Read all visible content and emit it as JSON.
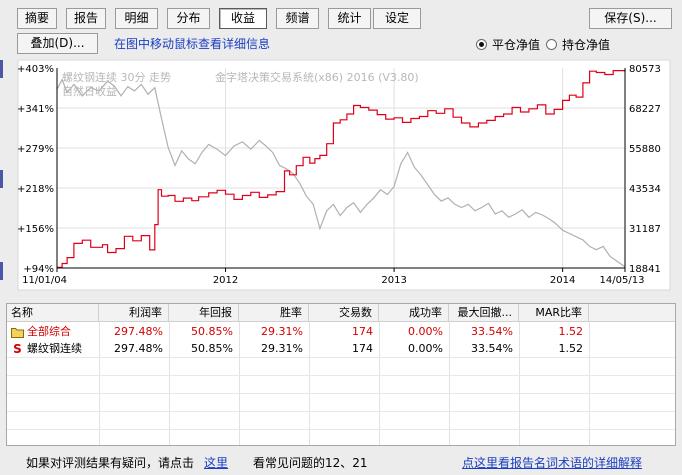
{
  "toolbar": {
    "tabs": [
      {
        "label": "摘要",
        "active": false
      },
      {
        "label": "报告",
        "active": false
      },
      {
        "label": "明细",
        "active": false
      },
      {
        "label": "分布",
        "active": false
      },
      {
        "label": "收益",
        "active": true
      },
      {
        "label": "频谱",
        "active": false
      },
      {
        "label": "统计",
        "active": false
      },
      {
        "label": "设定",
        "active": false
      }
    ],
    "save_label": "保存(S)...",
    "overlay_label": "叠加(D)...",
    "hint": "在图中移动鼠标查看详细信息",
    "mode_options": [
      {
        "label": "平仓净值",
        "selected": true
      },
      {
        "label": "持仓净值",
        "selected": false
      }
    ]
  },
  "chart": {
    "overlay_instrument": "螺纹钢连续 30分 走势",
    "overlay_system": "金字塔决策交易系统(x86) 2016 (V3.80)",
    "overlay_period": "自然日收益",
    "start_date": "11/01/04",
    "end_date": "14/05/13",
    "colors": {
      "equity": "#e0001a",
      "price": "#b0b0b0",
      "axis": "#000000"
    }
  },
  "chart_data": {
    "type": "line",
    "left_axis_ticks": [
      "+403%",
      "+341%",
      "+279%",
      "+218%",
      "+156%",
      "+94%"
    ],
    "right_axis_ticks": [
      "80573",
      "68227",
      "55880",
      "43534",
      "31187",
      "18841"
    ],
    "x_tick_labels": [
      "11/01/04",
      "2012",
      "2013",
      "2014",
      "14/05/13"
    ],
    "ylim_left_percent": [
      94,
      403
    ],
    "ylim_right_price": [
      18841,
      80573
    ],
    "x_years": [
      2011.0,
      2014.37
    ],
    "series": [
      {
        "name": "",
        "axis": "left",
        "x": [
          2011.0,
          2011.03,
          2011.06,
          2011.1,
          2011.15,
          2011.2,
          2011.27,
          2011.3,
          2011.35,
          2011.4,
          2011.45,
          2011.5,
          2011.55,
          2011.58,
          2011.6,
          2011.62,
          2011.66,
          2011.7,
          2011.75,
          2011.8,
          2011.84,
          2011.9,
          2011.95,
          2012.0,
          2012.05,
          2012.1,
          2012.15,
          2012.2,
          2012.25,
          2012.3,
          2012.35,
          2012.38,
          2012.42,
          2012.46,
          2012.5,
          2012.53,
          2012.56,
          2012.6,
          2012.64,
          2012.68,
          2012.72,
          2012.76,
          2012.8,
          2012.85,
          2012.9,
          2012.95,
          2013.0,
          2013.05,
          2013.1,
          2013.15,
          2013.2,
          2013.25,
          2013.3,
          2013.35,
          2013.4,
          2013.45,
          2013.5,
          2013.55,
          2013.6,
          2013.65,
          2013.7,
          2013.75,
          2013.8,
          2013.85,
          2013.9,
          2013.95,
          2014.0,
          2014.04,
          2014.08,
          2014.12,
          2014.16,
          2014.2,
          2014.25,
          2014.3,
          2014.37
        ],
        "values": [
          95,
          101,
          110,
          132,
          137,
          126,
          130,
          118,
          124,
          143,
          136,
          144,
          122,
          161,
          215,
          205,
          206,
          197,
          202,
          198,
          204,
          210,
          214,
          208,
          200,
          206,
          211,
          203,
          207,
          212,
          244,
          238,
          252,
          265,
          256,
          263,
          268,
          286,
          318,
          323,
          332,
          345,
          342,
          338,
          331,
          324,
          326,
          319,
          325,
          328,
          337,
          333,
          340,
          327,
          318,
          312,
          318,
          322,
          328,
          332,
          342,
          335,
          340,
          346,
          332,
          339,
          353,
          361,
          358,
          380,
          398,
          396,
          393,
          399,
          397
        ]
      },
      {
        "name": "",
        "axis": "right",
        "x": [
          2011.0,
          2011.03,
          2011.06,
          2011.1,
          2011.15,
          2011.2,
          2011.25,
          2011.3,
          2011.34,
          2011.38,
          2011.42,
          2011.46,
          2011.5,
          2011.54,
          2011.58,
          2011.62,
          2011.66,
          2011.7,
          2011.74,
          2011.78,
          2011.82,
          2011.86,
          2011.9,
          2011.95,
          2012.0,
          2012.05,
          2012.1,
          2012.15,
          2012.2,
          2012.24,
          2012.28,
          2012.32,
          2012.36,
          2012.4,
          2012.44,
          2012.48,
          2012.52,
          2012.56,
          2012.6,
          2012.64,
          2012.68,
          2012.72,
          2012.76,
          2012.8,
          2012.84,
          2012.88,
          2012.92,
          2012.96,
          2013.0,
          2013.04,
          2013.08,
          2013.12,
          2013.16,
          2013.2,
          2013.24,
          2013.28,
          2013.32,
          2013.36,
          2013.4,
          2013.44,
          2013.48,
          2013.52,
          2013.56,
          2013.6,
          2013.64,
          2013.68,
          2013.72,
          2013.76,
          2013.8,
          2013.84,
          2013.88,
          2013.92,
          2013.96,
          2014.0,
          2014.04,
          2014.08,
          2014.12,
          2014.16,
          2014.2,
          2014.24,
          2014.28,
          2014.32,
          2014.37
        ],
        "values": [
          74000,
          77000,
          73000,
          75500,
          72000,
          74500,
          73500,
          76500,
          75000,
          72000,
          74800,
          73500,
          75500,
          72500,
          74500,
          65000,
          56000,
          50500,
          55000,
          52500,
          51000,
          54500,
          57000,
          55500,
          53500,
          56500,
          57800,
          55500,
          58200,
          56500,
          54500,
          50500,
          49500,
          48000,
          45000,
          41000,
          38500,
          31000,
          36500,
          38500,
          35000,
          37500,
          39000,
          36000,
          38500,
          40500,
          43000,
          41500,
          44000,
          51000,
          54500,
          50000,
          47500,
          44500,
          41500,
          39500,
          40500,
          38500,
          37500,
          38500,
          36500,
          37500,
          38800,
          35500,
          36500,
          34500,
          35500,
          36800,
          34500,
          36000,
          35200,
          34000,
          32500,
          30500,
          29500,
          28500,
          27500,
          25500,
          24500,
          25500,
          22500,
          21000,
          19200
        ]
      }
    ]
  },
  "table": {
    "columns": [
      "名称",
      "利润率",
      "年回报",
      "胜率",
      "交易数",
      "成功率",
      "最大回撤...",
      "MAR比率"
    ],
    "rows": [
      {
        "name": "全部综合",
        "kind": "folder",
        "cells": [
          "297.48%",
          "50.85%",
          "29.31%",
          "174",
          "0.00%",
          "33.54%",
          "1.52"
        ]
      },
      {
        "name": "螺纹钢连续",
        "kind": "strategy",
        "cells": [
          "297.48%",
          "50.85%",
          "29.31%",
          "174",
          "0.00%",
          "33.54%",
          "1.52"
        ]
      }
    ],
    "row_icons": [
      "folder-icon",
      "strategy-s-icon"
    ],
    "strategy_mark": "S"
  },
  "footer": {
    "question_text": "如果对评测结果有疑问，请点击",
    "here_link": "这里",
    "faq_text": "看常见问题的12、21",
    "glossary_link": "点这里看报告名词术语的详细解释"
  }
}
